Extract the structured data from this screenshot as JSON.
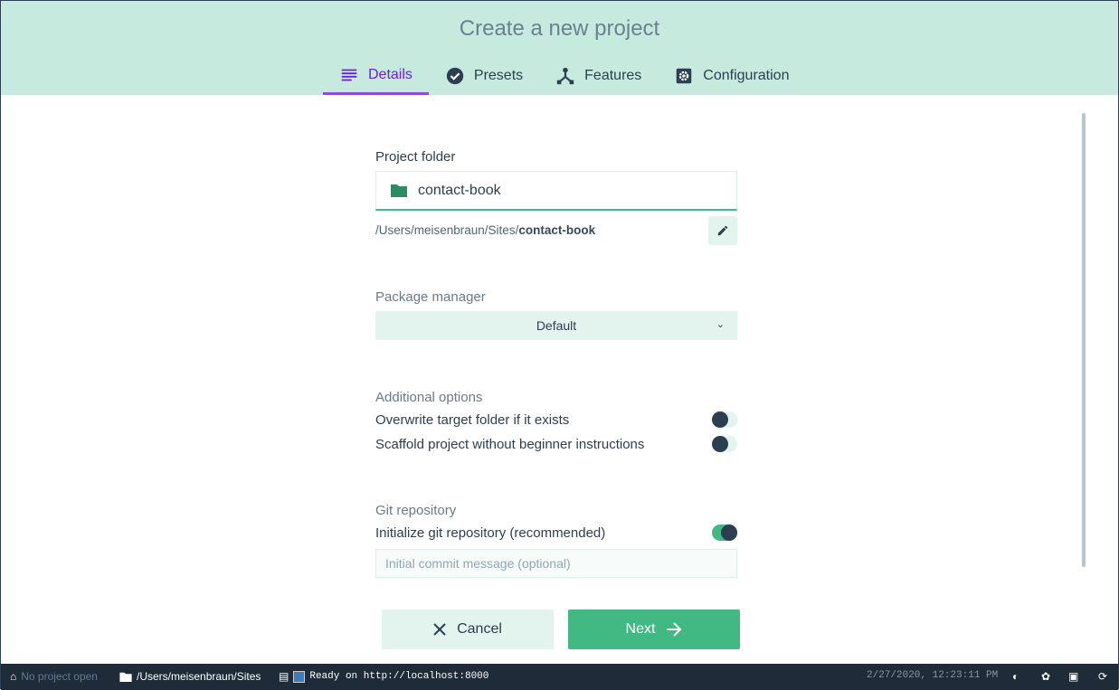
{
  "header": {
    "title": "Create a new project",
    "tabs": [
      {
        "label": "Details",
        "icon": "list-icon",
        "active": true
      },
      {
        "label": "Presets",
        "icon": "check-circle-icon"
      },
      {
        "label": "Features",
        "icon": "fork-icon"
      },
      {
        "label": "Configuration",
        "icon": "gear-icon"
      }
    ]
  },
  "folder": {
    "label": "Project folder",
    "value": "contact-book",
    "path_prefix": "/Users/meisenbraun/Sites/",
    "path_name": "contact-book"
  },
  "package_manager": {
    "label": "Package manager",
    "value": "Default"
  },
  "additional": {
    "label": "Additional options",
    "options": [
      {
        "label": "Overwrite target folder if it exists",
        "on": false
      },
      {
        "label": "Scaffold project without beginner instructions",
        "on": false
      }
    ]
  },
  "git": {
    "label": "Git repository",
    "init_label": "Initialize git repository (recommended)",
    "init_on": true,
    "commit_placeholder": "Initial commit message (optional)"
  },
  "actions": {
    "cancel": "Cancel",
    "next": "Next"
  },
  "statusbar": {
    "project": "No project open",
    "cwd": "/Users/meisenbraun/Sites",
    "log": "Ready on http://localhost:8000",
    "time": "2/27/2020, 12:23:11 PM"
  },
  "colors": {
    "accent": "#42b983",
    "header_bg": "#c6eadd",
    "active_tab": "#6b21d2",
    "statusbar_bg": "#1f2b38"
  }
}
